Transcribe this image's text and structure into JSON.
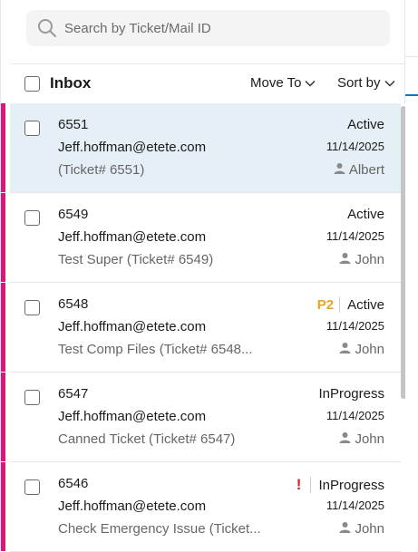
{
  "search": {
    "placeholder": "Search by Ticket/Mail ID",
    "icon": "search-icon"
  },
  "header": {
    "title": "Inbox",
    "move_to": "Move To",
    "sort_by": "Sort by"
  },
  "colors": {
    "accent_bar": "#d7197e",
    "selected_bg": "#e4f0f6",
    "priority": "#f0a020",
    "urgent": "#e02020",
    "tab_underline": "#1a73b8"
  },
  "tickets": [
    {
      "id": "6551",
      "email": "Jeff.hoffman@etete.com",
      "subject": "(Ticket# 6551)",
      "status": "Active",
      "date": "11/14/2025",
      "agent": "Albert",
      "priority": "",
      "urgent": "",
      "selected": true
    },
    {
      "id": "6549",
      "email": "Jeff.hoffman@etete.com",
      "subject": "Test Super (Ticket# 6549)",
      "status": "Active",
      "date": "11/14/2025",
      "agent": "John",
      "priority": "",
      "urgent": "",
      "selected": false
    },
    {
      "id": "6548",
      "email": "Jeff.hoffman@etete.com",
      "subject": "Test Comp Files (Ticket# 6548...",
      "status": "Active",
      "date": "11/14/2025",
      "agent": "John",
      "priority": "P2",
      "urgent": "",
      "selected": false
    },
    {
      "id": "6547",
      "email": "Jeff.hoffman@etete.com",
      "subject": "Canned Ticket (Ticket# 6547)",
      "status": "InProgress",
      "date": "11/14/2025",
      "agent": "John",
      "priority": "",
      "urgent": "",
      "selected": false
    },
    {
      "id": "6546",
      "email": "Jeff.hoffman@etete.com",
      "subject": "Check Emergency Issue (Ticket...",
      "status": "InProgress",
      "date": "11/14/2025",
      "agent": "John",
      "priority": "",
      "urgent": "!",
      "selected": false
    }
  ]
}
